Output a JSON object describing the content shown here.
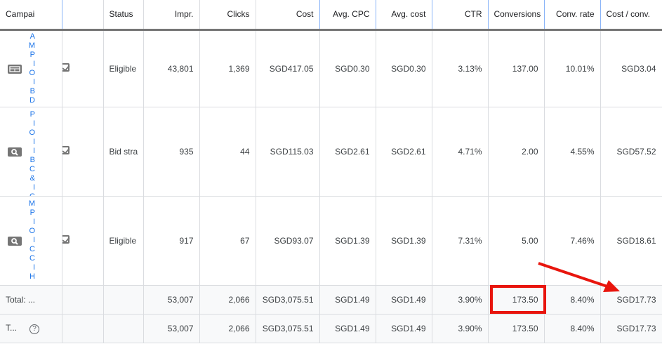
{
  "headers": {
    "campaign": "Campai",
    "status": "Status",
    "impr": "Impr.",
    "clicks": "Clicks",
    "cost": "Cost",
    "avg_cpc": "Avg. CPC",
    "avg_cost": "Avg. cost",
    "ctr": "CTR",
    "conversions": "Conversions",
    "conv_rate": "Conv. rate",
    "cost_conv": "Cost / conv."
  },
  "rows": [
    {
      "type_icon": "display-icon",
      "name": "AMPIOIBD",
      "status": "Eligible",
      "impr": "43,801",
      "clicks": "1,369",
      "cost": "SGD417.05",
      "avg_cpc": "SGD0.30",
      "avg_cost": "SGD0.30",
      "ctr": "3.13%",
      "conversions": "137.00",
      "conv_rate": "10.01%",
      "cost_conv": "SGD3.04"
    },
    {
      "type_icon": "search-icon",
      "name": "MPIOIIBC&IC",
      "status": "Bid stra",
      "impr": "935",
      "clicks": "44",
      "cost": "SGD115.03",
      "avg_cpc": "SGD2.61",
      "avg_cost": "SGD2.61",
      "ctr": "4.71%",
      "conversions": "2.00",
      "conv_rate": "4.55%",
      "cost_conv": "SGD57.52"
    },
    {
      "type_icon": "search-icon",
      "name": "MPIOICCIH",
      "status": "Eligible",
      "impr": "917",
      "clicks": "67",
      "cost": "SGD93.07",
      "avg_cpc": "SGD1.39",
      "avg_cost": "SGD1.39",
      "ctr": "7.31%",
      "conversions": "5.00",
      "conv_rate": "7.46%",
      "cost_conv": "SGD18.61"
    }
  ],
  "totals": [
    {
      "label": "Total: ...",
      "impr": "53,007",
      "clicks": "2,066",
      "cost": "SGD3,075.51",
      "avg_cpc": "SGD1.49",
      "avg_cost": "SGD1.49",
      "ctr": "3.90%",
      "conversions": "173.50",
      "conv_rate": "8.40%",
      "cost_conv": "SGD17.73"
    },
    {
      "label": "T...",
      "help": "?",
      "impr": "53,007",
      "clicks": "2,066",
      "cost": "SGD3,075.51",
      "avg_cpc": "SGD1.49",
      "avg_cost": "SGD1.49",
      "ctr": "3.90%",
      "conversions": "173.50",
      "conv_rate": "8.40%",
      "cost_conv": "SGD17.73"
    }
  ],
  "annotation_color": "#e8150d"
}
